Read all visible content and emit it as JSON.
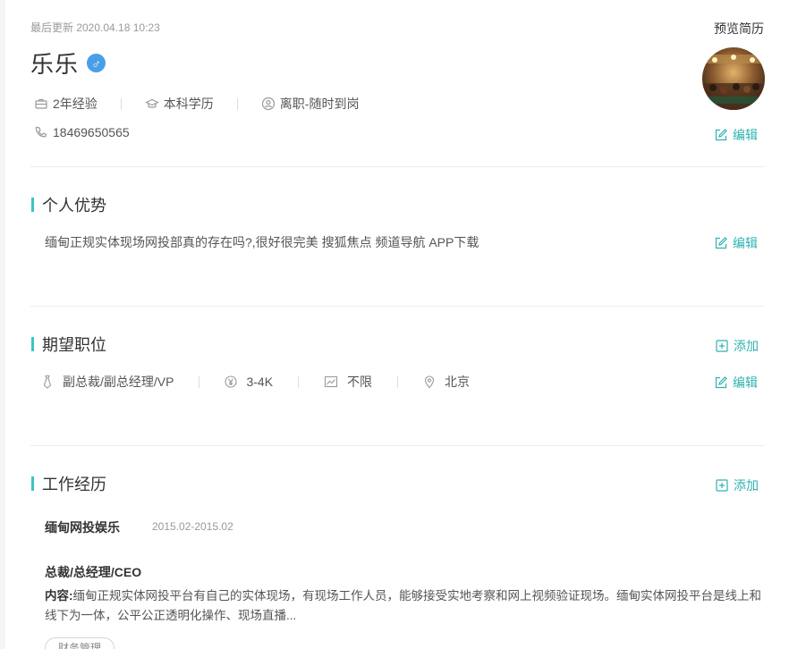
{
  "header": {
    "last_updated": "最后更新 2020.04.18 10:23",
    "preview_label": "预览简历",
    "name": "乐乐",
    "gender_symbol": "♂",
    "experience": "2年经验",
    "education": "本科学历",
    "status": "离职-随时到岗",
    "phone": "18469650565",
    "edit_label": "编辑"
  },
  "advantage": {
    "title": "个人优势",
    "text": "缅甸正规实体现场网投部真的存在吗?,很好很完美 搜狐焦点 频道导航 APP下载",
    "edit_label": "编辑"
  },
  "expected_job": {
    "title": "期望职位",
    "add_label": "添加",
    "edit_label": "编辑",
    "position": "副总裁/副总经理/VP",
    "salary": "3-4K",
    "industry": "不限",
    "city": "北京"
  },
  "work_experience": {
    "title": "工作经历",
    "add_label": "添加",
    "items": [
      {
        "company": "缅甸网投娱乐",
        "dates": "2015.02-2015.02",
        "position": "总裁/总经理/CEO",
        "content_label": "内容:",
        "content": "缅甸正规实体网投平台有自己的实体现场，有现场工作人员，能够接受实地考察和网上视频验证现场。缅甸实体网投平台是线上和线下为一体，公平公正透明化操作、现场直播...",
        "tag": "财务管理"
      }
    ]
  },
  "colors": {
    "accent": "#2fb1b1",
    "section_bar": "#3cc3c3",
    "gender_badge": "#4a9ee8"
  }
}
